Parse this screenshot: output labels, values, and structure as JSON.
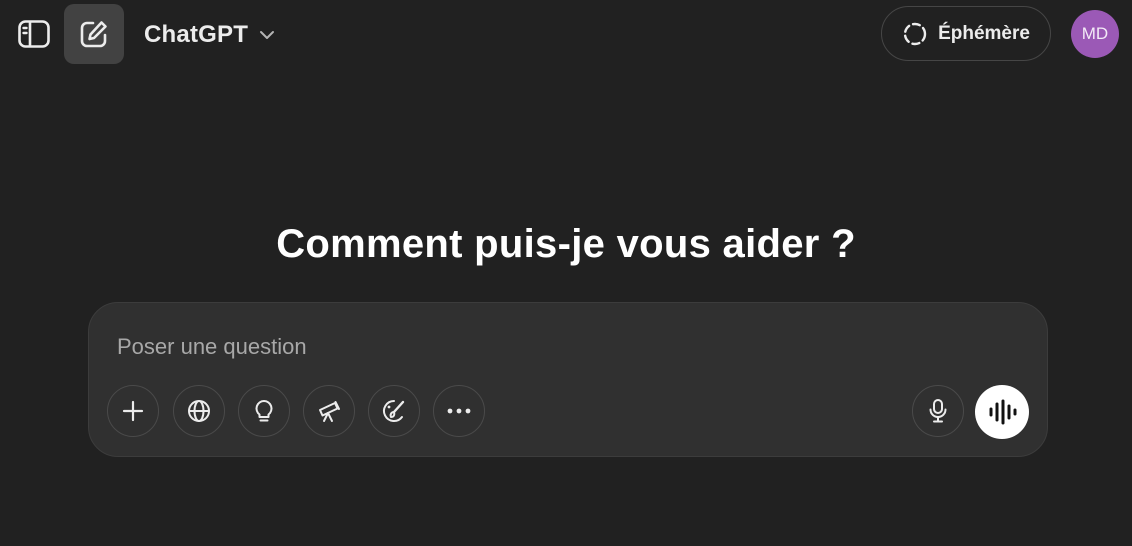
{
  "header": {
    "model_name": "ChatGPT",
    "ephemere_label": "Éphémère",
    "avatar_initials": "MD",
    "avatar_color": "#9b59b6"
  },
  "main": {
    "heading": "Comment puis-je vous aider ?"
  },
  "composer": {
    "placeholder": "Poser une question",
    "value": "",
    "tools": [
      {
        "icon": "plus-icon"
      },
      {
        "icon": "globe-icon"
      },
      {
        "icon": "lightbulb-icon"
      },
      {
        "icon": "telescope-icon"
      },
      {
        "icon": "paintbrush-icon"
      },
      {
        "icon": "more-icon"
      }
    ],
    "right_actions": [
      {
        "icon": "microphone-icon"
      },
      {
        "icon": "voice-waveform-icon"
      }
    ]
  },
  "colors": {
    "background": "#212121",
    "composer_bg": "#303030",
    "new_chat_bg": "#424242",
    "text": "#ececec"
  }
}
